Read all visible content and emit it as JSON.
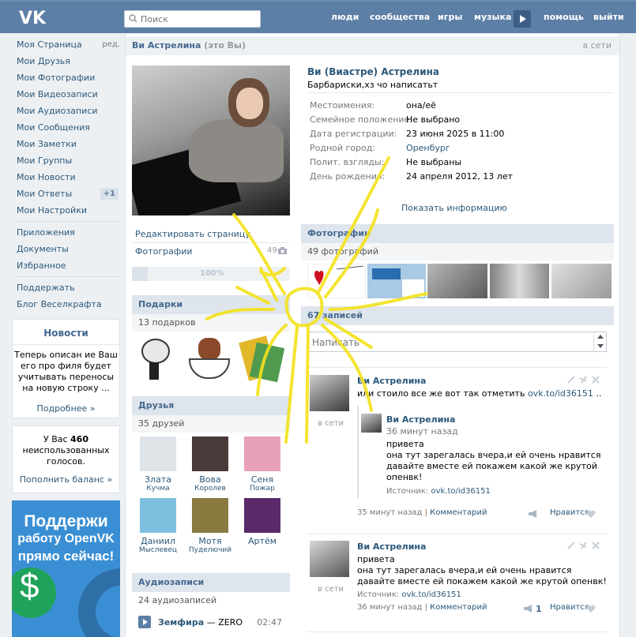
{
  "topbar": {
    "search_placeholder": "Поиск",
    "nav": [
      "люди",
      "сообщества",
      "игры",
      "музыка",
      "помощь",
      "выйти"
    ]
  },
  "sidebar": {
    "items": [
      {
        "label": "Моя Страница",
        "extra": "ред."
      },
      {
        "label": "Мои Друзья"
      },
      {
        "label": "Мои Фотографии"
      },
      {
        "label": "Мои Видеозаписи"
      },
      {
        "label": "Мои Аудиозаписи"
      },
      {
        "label": "Мои Сообщения"
      },
      {
        "label": "Мои Заметки"
      },
      {
        "label": "Мои Группы"
      },
      {
        "label": "Мои Новости"
      },
      {
        "label": "Мои Ответы",
        "badge": "+1"
      },
      {
        "label": "Мои Настройки"
      }
    ],
    "items2": [
      "Приложения",
      "Документы",
      "Избранное"
    ],
    "items3": [
      "Поддержать",
      "Блог Веселкрафта"
    ],
    "news": {
      "title": "Новости",
      "text": [
        "Теперь описан ие Ваш",
        "его про филя будет",
        "учитывать переносы",
        "на новую строку ..."
      ],
      "more": "Подробнее »"
    },
    "votes": {
      "prefix": "У Вас ",
      "count": "460",
      "line2": "неиспользованных",
      "line3": "голосов.",
      "link": "Пополнить баланс »"
    },
    "ad": {
      "lines": [
        "Поддержи",
        "работу OpenVK",
        "прямо сейчас!"
      ]
    }
  },
  "profile": {
    "header_name": "Ви Астрелина",
    "header_you": "(это Вы)",
    "status": "в сети",
    "full_name": "Ви (Виастре) Астрелина",
    "status_text": "Барбариски,хз чо написатьт",
    "info": [
      [
        "Местоимения:",
        "она/её"
      ],
      [
        "Семейное положение:",
        "Не выбрано"
      ],
      [
        "Дата регистрации:",
        "23 июня 2025 в 11:00"
      ],
      [
        "Родной город:",
        "Оренбург"
      ],
      [
        "Полит. взгляды:",
        "Не выбраны"
      ],
      [
        "День рождения:",
        "24 апреля 2012, 13 лет"
      ]
    ],
    "show_info": "Показать информацию",
    "edit": "Редактировать страницу",
    "photos_link": "Фотографии",
    "photos_count": "49",
    "completion": "100%"
  },
  "gifts": {
    "title": "Подарки",
    "count": "13 подарков"
  },
  "friends": {
    "title": "Друзья",
    "count": "35 друзей",
    "list": [
      [
        "Злата",
        "Кучма"
      ],
      [
        "Вова",
        "Королев"
      ],
      [
        "Сеня",
        "Пожар"
      ],
      [
        "Даниил",
        "Мыслевец"
      ],
      [
        "Мотя",
        "Пуделючий"
      ],
      [
        "Артём",
        ""
      ]
    ]
  },
  "audio": {
    "title": "Аудиозаписи",
    "count": "24 аудиозаписей",
    "artist": "Земфира",
    "sep": " — ",
    "song": "ZERO",
    "duration": "02:47"
  },
  "photos": {
    "title": "Фотографии",
    "count": "49 фотографий"
  },
  "wall": {
    "title": "67 записей",
    "placeholder": "Написать"
  },
  "posts": [
    {
      "author": "Ви Астрелина",
      "text": "или стоило все же вот так отметить ",
      "link": "ovk.to/id36151",
      "tail": " ..",
      "online": "в сети",
      "repost": {
        "author": "Ви Астрелина",
        "time": "36 минут назад",
        "lines": [
          "привета",
          "она тут зарегалась вчера,и ей очень нравится",
          "давайте вместе ей покажем какой же крутой",
          "опенвк!"
        ],
        "source_label": "Источник: ",
        "source": "ovk.to/id36151"
      },
      "time": "35 минут назад",
      "comment": "Комментарий",
      "like": "Нравится"
    },
    {
      "author": "Ви Астрелина",
      "lines": [
        "привета",
        "она тут зарегалась вчера,и ей очень нравится",
        "давайте вместе ей покажем какой же крутой опенвк!"
      ],
      "source_label": "Источник: ",
      "source": "ovk.to/id36151",
      "online": "в сети",
      "time": "36 минут назад",
      "comment": "Комментарий",
      "likes": "1",
      "like": "Нравится"
    }
  ]
}
